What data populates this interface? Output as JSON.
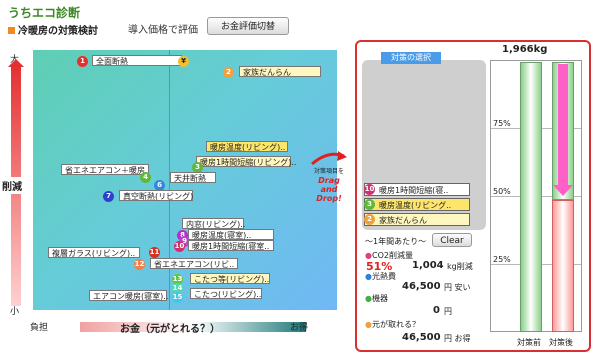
{
  "app": {
    "title": "うちエコ診断"
  },
  "section": {
    "title": "冷暖房の対策検討",
    "price_label": "導入価格で評価",
    "switch_button": "お金評価切替"
  },
  "yaxis": {
    "top": "大",
    "label": "削減",
    "bottom": "小"
  },
  "xaxis": {
    "left": "負担",
    "middle": "お金（元がとれる？）",
    "right": "お得"
  },
  "yen_icon": "¥",
  "items": [
    {
      "num": "1",
      "label": "全面断熱",
      "color": "#e53030",
      "style": "w"
    },
    {
      "num": "2",
      "label": "家族だんらん",
      "color": "#f0a040",
      "style": "ly"
    },
    {
      "num": "3",
      "label": "暖房温度(リビング)..",
      "color": "#5fb83a",
      "style": "y"
    },
    {
      "num": "",
      "label": "暖房1時間短縮(リビング)..",
      "color": "",
      "style": "w"
    },
    {
      "num": "",
      "label": "省エネエアコン＋暖房",
      "color": "",
      "style": "w"
    },
    {
      "num": "5",
      "label": "天井断熱",
      "color": "#28c8e0",
      "style": "w"
    },
    {
      "num": "6",
      "label": "",
      "color": "#2e8ae0",
      "style": "w"
    },
    {
      "num": "7",
      "label": "真空断熱(リビング)",
      "color": "#2f3fd0",
      "style": "w"
    },
    {
      "num": "8",
      "label": "内窓(リビング)..",
      "color": "#b030c8",
      "style": "w"
    },
    {
      "num": "9",
      "label": "暖房温度(寝室)..",
      "color": "#c040d0",
      "style": "w"
    },
    {
      "num": "10",
      "label": "暖房1時間短縮(寝室..",
      "color": "#d03070",
      "style": "w"
    },
    {
      "num": "11",
      "label": "複層ガラス(リビング)..",
      "color": "#d83020",
      "style": "w"
    },
    {
      "num": "12",
      "label": "省エネエアコン(リビ..",
      "color": "#f08050",
      "style": "w"
    },
    {
      "num": "13",
      "label": "こたつ等(リビング)..",
      "color": "#60c840",
      "style": "ly"
    },
    {
      "num": "14",
      "label": "エアコン暖房(寝室)..",
      "color": "#50d8b0",
      "style": "w"
    },
    {
      "num": "15",
      "label": "こたつ(リビング)..",
      "color": "#40c8e8",
      "style": "w"
    },
    {
      "num": "4",
      "label": "",
      "color": "#5fb83a",
      "style": "w"
    }
  ],
  "dnd": {
    "line1": "対策項目を",
    "line2": "Drag",
    "line3": "and",
    "line4": "Drop!"
  },
  "selection": {
    "title": "対策の選択",
    "items": [
      {
        "num": "10",
        "label": "暖房1時間短縮(寝..",
        "color": "#d03070",
        "bg": "#ffffff"
      },
      {
        "num": "3",
        "label": "暖房温度(リビング..",
        "color": "#5fb83a",
        "bg": "#fde46b"
      },
      {
        "num": "2",
        "label": "家族だんらん",
        "color": "#f0a040",
        "bg": "#fff7c0"
      }
    ]
  },
  "stats": {
    "per_year": "～1年間あたり～",
    "clear_button": "Clear",
    "co2_label": "CO2削減量",
    "co2_pct": "51%",
    "co2_value": "1,004",
    "co2_unit": "kg削減",
    "cost_label": "光熱費",
    "cost_value": "46,500",
    "cost_unit": "円 安い",
    "equip_label": "機器",
    "equip_value": "0",
    "equip_unit": "円",
    "payback_label": "元が取れる？",
    "payback_value": "46,500",
    "payback_unit": "円 お得"
  },
  "bars": {
    "total": "1,966kg",
    "pct75": "75%",
    "pct50": "50%",
    "pct25": "25%",
    "before_label": "対策前",
    "after_label": "対策後",
    "after_fraction": 0.49
  }
}
